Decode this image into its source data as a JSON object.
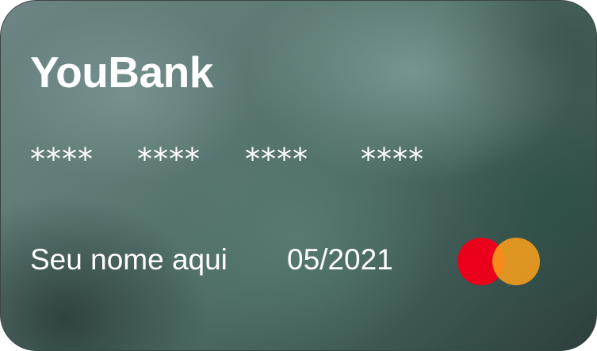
{
  "card": {
    "brand": "YouBank",
    "number_groups": [
      "****",
      "****",
      "****",
      "****"
    ],
    "holder_name": "Seu nome aqui",
    "expiry": "05/2021",
    "network_logo": "mastercard-logo",
    "colors": {
      "logo_red": "#eb001b",
      "logo_orange": "#f79e1b",
      "text": "#ffffff"
    }
  }
}
